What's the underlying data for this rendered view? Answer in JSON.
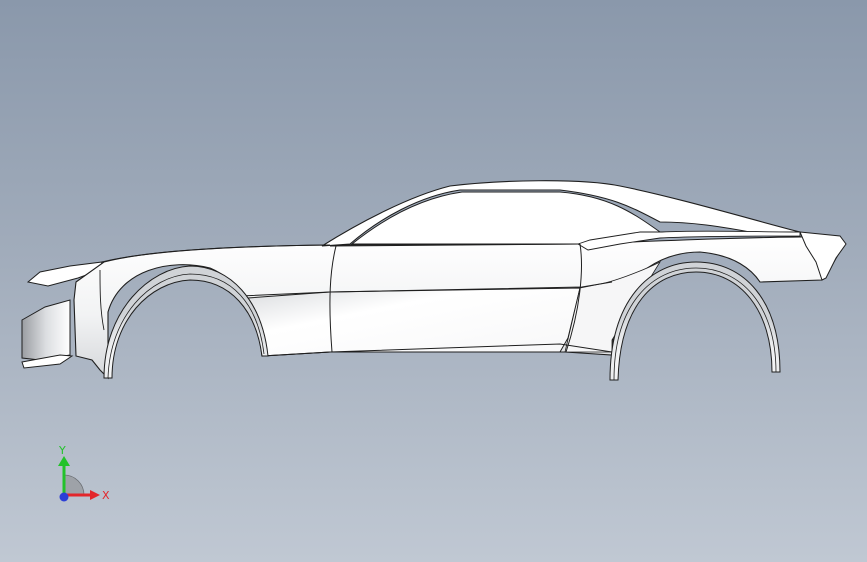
{
  "viewport": {
    "background_top": "#8a98ab",
    "background_bottom": "#c0c8d3"
  },
  "model": {
    "body_fill": "#ffffff",
    "edge_color": "#1f1f1f",
    "shade_color": "#cfd2d6"
  },
  "triad": {
    "x_label": "X",
    "y_label": "Y",
    "x_color": "#e3262b",
    "y_color": "#22c22a",
    "z_color": "#2c3fd6",
    "icon": "coordinate-triad-icon"
  }
}
